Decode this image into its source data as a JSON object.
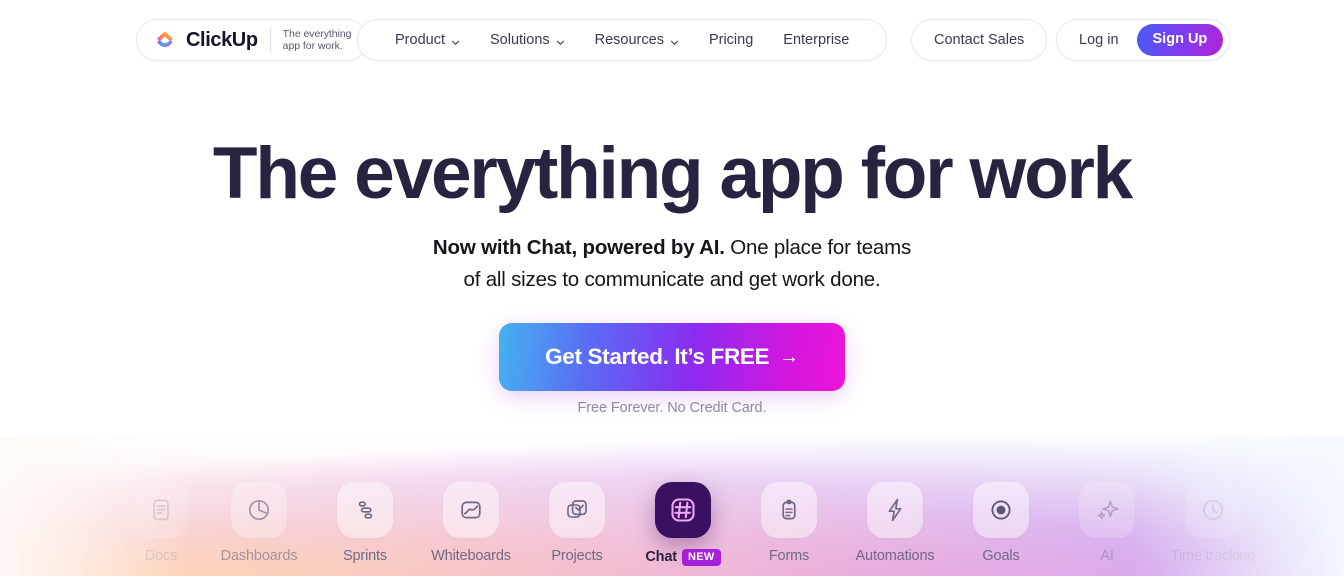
{
  "header": {
    "logo": {
      "icon": "clickup-logo-icon",
      "wordmark": "ClickUp",
      "tagline_line1": "The everything",
      "tagline_line2": "app for work."
    },
    "nav_items": [
      {
        "label": "Product",
        "has_dropdown": true,
        "icon": "chevron-down-icon"
      },
      {
        "label": "Solutions",
        "has_dropdown": true,
        "icon": "chevron-down-icon"
      },
      {
        "label": "Resources",
        "has_dropdown": true,
        "icon": "chevron-down-icon"
      },
      {
        "label": "Pricing",
        "has_dropdown": false,
        "icon": ""
      },
      {
        "label": "Enterprise",
        "has_dropdown": false,
        "icon": ""
      }
    ],
    "contact_sales_label": "Contact Sales",
    "login_label": "Log in",
    "signup_label": "Sign Up",
    "signup_gradient": "#4a5cf5 → #b023d8"
  },
  "hero": {
    "headline": "The everything app for work",
    "subtitle_bold": "Now with Chat, powered by AI.",
    "subtitle_rest": " One place for teams",
    "subtitle_line2": "of all sizes to communicate and get work done.",
    "cta_label": "Get Started. It’s FREE",
    "cta_arrow": "→",
    "cta_gradient": "#44b2f0 → #8b2bf0 → #ee14d8",
    "fine_print": "Free Forever. No Credit Card.",
    "headline_color": "#292342"
  },
  "carousel": {
    "items": [
      {
        "label": "Docs",
        "icon": "document-icon",
        "active": false,
        "visibility": "clipped-left"
      },
      {
        "label": "Dashboards",
        "icon": "pie-chart-icon",
        "active": false,
        "visibility": "faded"
      },
      {
        "label": "Sprints",
        "icon": "sprint-bars-icon",
        "active": false,
        "visibility": "full"
      },
      {
        "label": "Whiteboards",
        "icon": "whiteboard-icon",
        "active": false,
        "visibility": "full"
      },
      {
        "label": "Projects",
        "icon": "project-check-icon",
        "active": false,
        "visibility": "full"
      },
      {
        "label": "Chat",
        "icon": "hash-chat-icon",
        "active": true,
        "badge": "NEW",
        "visibility": "full"
      },
      {
        "label": "Forms",
        "icon": "clipboard-icon",
        "active": false,
        "visibility": "full"
      },
      {
        "label": "Automations",
        "icon": "lightning-icon",
        "active": false,
        "visibility": "full"
      },
      {
        "label": "Goals",
        "icon": "target-icon",
        "active": false,
        "visibility": "full"
      },
      {
        "label": "AI",
        "icon": "sparkles-icon",
        "active": false,
        "visibility": "faded"
      },
      {
        "label": "Time tracking",
        "icon": "clock-icon",
        "active": false,
        "visibility": "clipped-right"
      }
    ],
    "active_badge_color": "#a520d8",
    "active_tile_color": "#3a1160"
  }
}
